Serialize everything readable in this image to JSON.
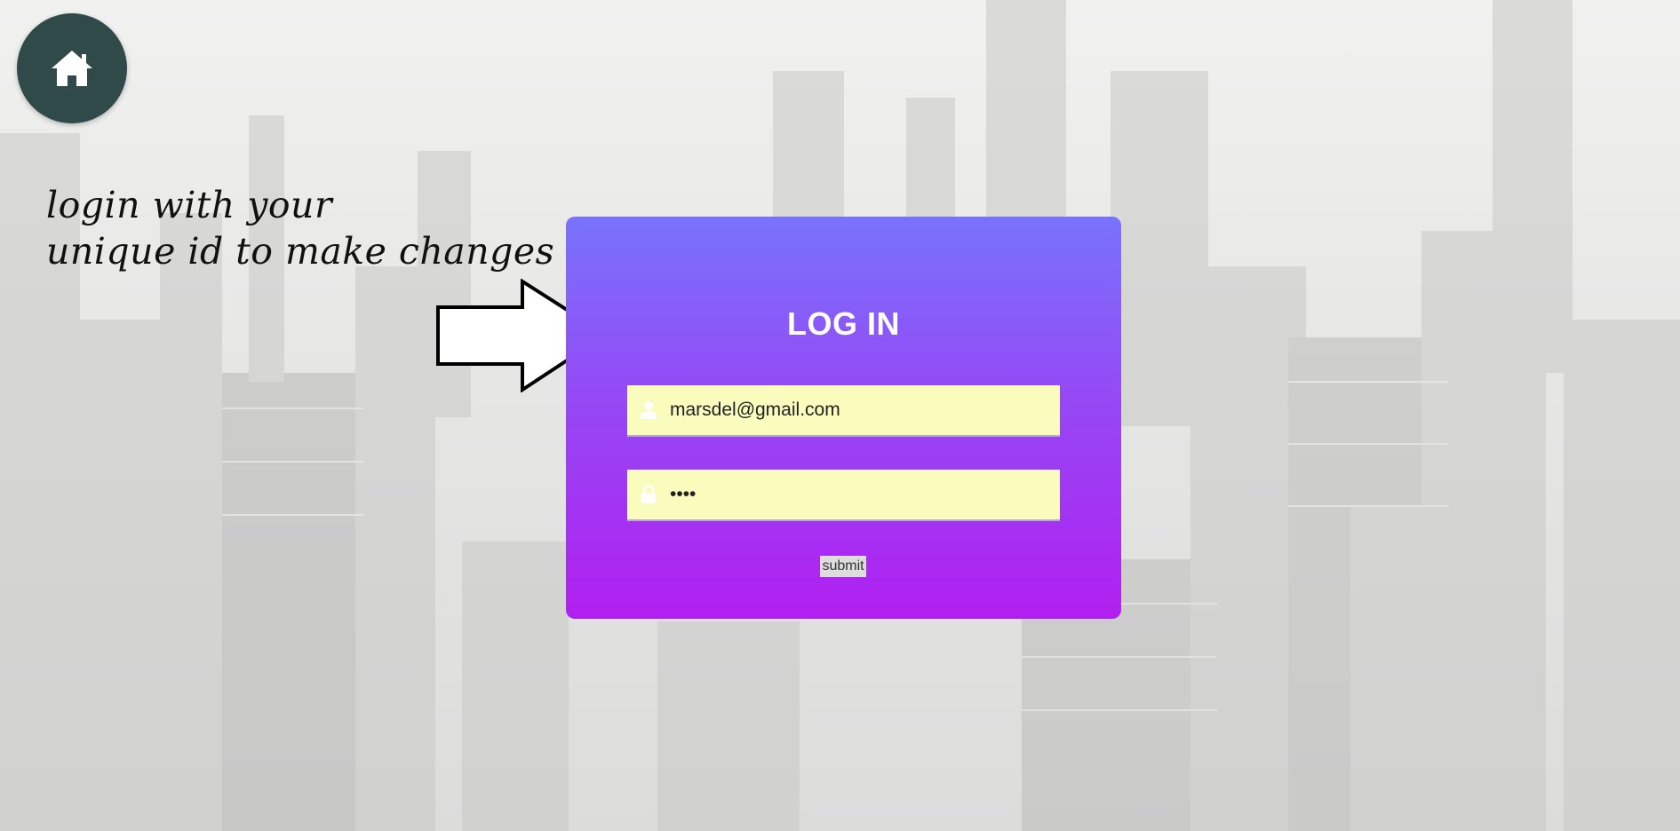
{
  "nav": {
    "home_icon": "home-icon"
  },
  "hint": {
    "line1": "login with your",
    "line2": "unique id to make changes"
  },
  "login": {
    "title": "LOG IN",
    "email_icon": "user-icon",
    "email_value": "marsdel@gmail.com",
    "password_icon": "lock-icon",
    "password_value": "••••",
    "submit_label": "submit"
  },
  "colors": {
    "card_top": "#7873fc",
    "card_bottom": "#b11ff0",
    "field_bg": "#fafcbe",
    "home_bg": "#2f4a48"
  }
}
